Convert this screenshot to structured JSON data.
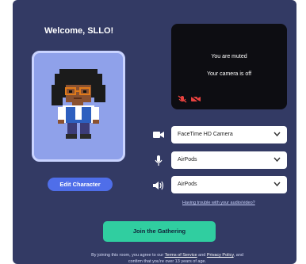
{
  "welcome": {
    "title": "Welcome, SLLO!"
  },
  "character": {
    "edit_label": "Edit Character"
  },
  "preview": {
    "muted_text": "You are muted",
    "camera_text": "Your camera is off",
    "mic_icon": "mic-off-icon",
    "cam_icon": "camera-off-icon"
  },
  "devices": {
    "camera": {
      "value": "FaceTime HD Camera",
      "icon": "camera-icon"
    },
    "microphone": {
      "value": "AirPods",
      "icon": "microphone-icon"
    },
    "speaker": {
      "value": "AirPods",
      "icon": "speaker-icon"
    },
    "help_link": "Having trouble with your audio/video?"
  },
  "join": {
    "label": "Join the Gathering"
  },
  "legal": {
    "prefix": "By joining this room, you agree to our ",
    "terms": "Terms of Service",
    "and": " and ",
    "privacy": "Privacy Policy",
    "suffix": ", and confirm that you're over 13 years of age."
  },
  "colors": {
    "background": "#333a64",
    "accent_blue": "#4f6ee9",
    "accent_green": "#30cea0",
    "muted_red": "#e8423f"
  }
}
